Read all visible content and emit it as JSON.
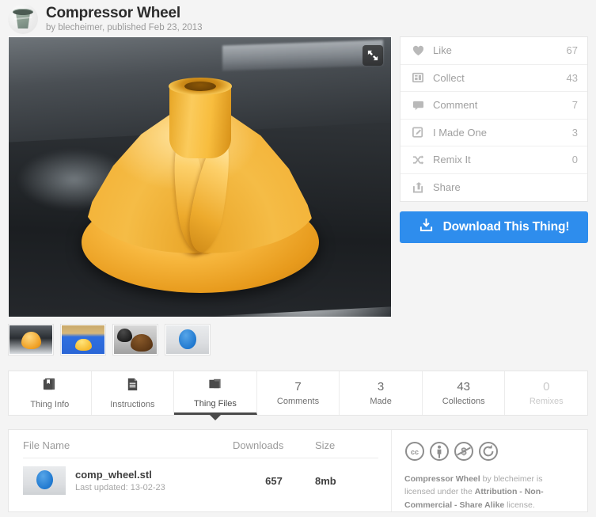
{
  "header": {
    "title": "Compressor Wheel",
    "byline": "by blecheimer, published Feb 23, 2013",
    "avatar_icon": "bucket-avatar"
  },
  "hero": {
    "alt": "3D printed orange compressor wheel impeller on dark build plate",
    "expand_icon": "fullscreen-expand-icon"
  },
  "thumbnails": [
    {
      "name": "thumb-orange-wheel-dark-plate"
    },
    {
      "name": "thumb-yellow-wheel-blue-bed"
    },
    {
      "name": "thumb-black-and-brown-wheels"
    },
    {
      "name": "thumb-blue-stl-render"
    }
  ],
  "actions": [
    {
      "icon": "heart-icon",
      "label": "Like",
      "count": "67"
    },
    {
      "icon": "collect-icon",
      "label": "Collect",
      "count": "43"
    },
    {
      "icon": "comment-icon",
      "label": "Comment",
      "count": "7"
    },
    {
      "icon": "made-icon",
      "label": "I Made One",
      "count": "3"
    },
    {
      "icon": "remix-icon",
      "label": "Remix It",
      "count": "0"
    },
    {
      "icon": "share-icon",
      "label": "Share",
      "count": ""
    }
  ],
  "download": {
    "label": "Download This Thing!",
    "icon": "download-icon",
    "color": "#2e8ded"
  },
  "tabs": [
    {
      "icon": "book-icon",
      "num": "",
      "label": "Thing Info",
      "active": false,
      "disabled": false
    },
    {
      "icon": "document-icon",
      "num": "",
      "label": "Instructions",
      "active": false,
      "disabled": false
    },
    {
      "icon": "folder-icon",
      "num": "",
      "label": "Thing Files",
      "active": true,
      "disabled": false
    },
    {
      "icon": "",
      "num": "7",
      "label": "Comments",
      "active": false,
      "disabled": false
    },
    {
      "icon": "",
      "num": "3",
      "label": "Made",
      "active": false,
      "disabled": false
    },
    {
      "icon": "",
      "num": "43",
      "label": "Collections",
      "active": false,
      "disabled": false
    },
    {
      "icon": "",
      "num": "0",
      "label": "Remixes",
      "active": false,
      "disabled": true
    }
  ],
  "files": {
    "columns": {
      "name": "File Name",
      "downloads": "Downloads",
      "size": "Size"
    },
    "rows": [
      {
        "name": "comp_wheel.stl",
        "updated": "Last updated: 13-02-23",
        "downloads": "657",
        "size": "8mb",
        "thumb": "stl-preview-thumb"
      }
    ]
  },
  "license": {
    "icons": [
      "cc-icon",
      "cc-by-icon",
      "cc-nc-icon",
      "cc-sa-icon"
    ],
    "prefix": "Compressor Wheel",
    "mid": " by blecheimer is licensed under the ",
    "terms": "Attribution - Non-Commercial - Share Alike",
    "suffix": " license."
  }
}
